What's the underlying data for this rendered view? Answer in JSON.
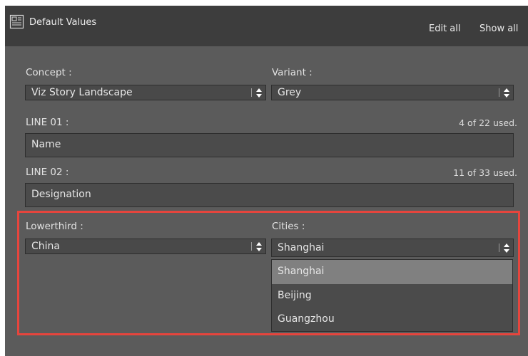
{
  "header": {
    "title": "Default Values",
    "title_icon": "template-list-icon",
    "edit_all_label": "Edit all",
    "show_all_label": "Show all"
  },
  "concept": {
    "label": "Concept :",
    "value": "Viz Story Landscape"
  },
  "variant": {
    "label": "Variant :",
    "value": "Grey"
  },
  "line01": {
    "label": "LINE 01 :",
    "value": "Name",
    "usage": "4 of 22 used."
  },
  "line02": {
    "label": "LINE 02 :",
    "value": "Designation",
    "usage": "11 of 33 used."
  },
  "lowerthird": {
    "label": "Lowerthird :",
    "value": "China"
  },
  "cities": {
    "label": "Cities :",
    "value": "Shanghai",
    "options": [
      "Shanghai",
      "Beijing",
      "Guangzhou"
    ],
    "highlighted_option": "Shanghai"
  },
  "colors": {
    "panel_bg": "#5b5b5b",
    "titlebar_bg": "#3d3d3d",
    "field_bg": "#4b4b4b",
    "highlight_border": "#e6453d",
    "selected_option_bg": "#808080"
  }
}
